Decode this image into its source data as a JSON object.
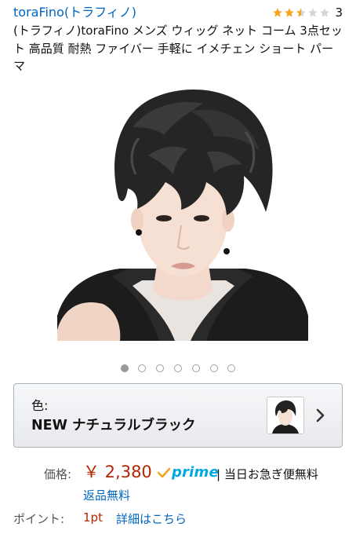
{
  "brand": {
    "link_text": "toraFino(トラフィノ)"
  },
  "rating": {
    "stars": 2.5,
    "max": 5,
    "count": "3",
    "star_color": "#f4a41d",
    "empty_color": "#d5d5d5"
  },
  "product": {
    "title": "(トラフィノ)toraFino メンズ ウィッグ ネット コーム 3点セット 高品質 耐熱 ファイバー 手軽に イメチェン ショート パーマ"
  },
  "carousel": {
    "total": 7,
    "active_index": 0
  },
  "variation": {
    "label": "色:",
    "value": "NEW ナチュラルブラック"
  },
  "price": {
    "label": "価格:",
    "value": "￥ 2,380",
    "prime": "prime",
    "delivery": "| 当日お急ぎ便無料",
    "returns": "返品無料"
  },
  "points": {
    "label": "ポイント:",
    "value": "1pt",
    "details_link": "詳細はこちら"
  },
  "colors": {
    "link": "#0066c0",
    "price": "#b12704",
    "prime": "#00a8e1",
    "star": "#f4a41d"
  },
  "icons": {
    "rating": "star-icon",
    "prime": "prime-check-icon",
    "chevron": "chevron-right-icon"
  }
}
